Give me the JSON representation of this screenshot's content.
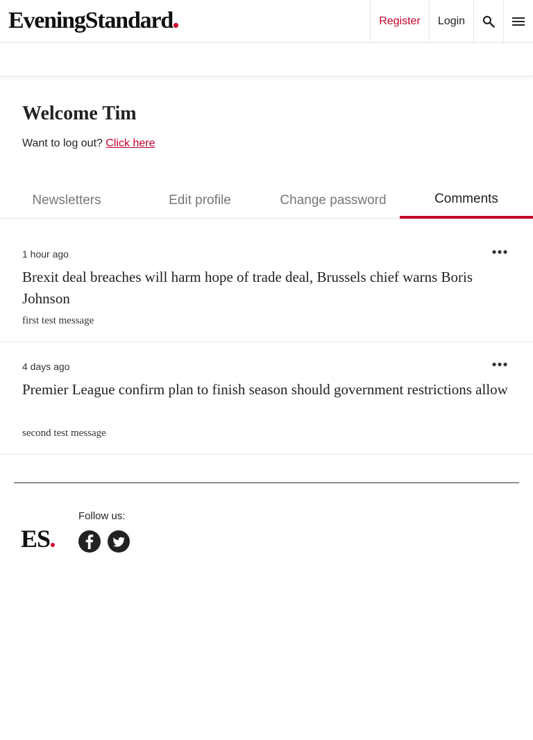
{
  "header": {
    "logo_text": "EveningStandard",
    "register_label": "Register",
    "login_label": "Login",
    "search_icon": "search-icon",
    "menu_icon": "hamburger-menu-icon",
    "accent_color": "#c4002a"
  },
  "welcome": {
    "title": "Welcome Tim",
    "logout_prompt": "Want to log out?",
    "logout_link": "Click here"
  },
  "tabs": [
    {
      "label": "Newsletters",
      "active": false
    },
    {
      "label": "Edit profile",
      "active": false
    },
    {
      "label": "Change password",
      "active": false
    },
    {
      "label": "Comments",
      "active": true
    }
  ],
  "comments": [
    {
      "time": "1 hour ago",
      "title": "Brexit deal breaches will harm hope of trade deal, Brussels chief warns Boris Johnson",
      "message": "first test message"
    },
    {
      "time": "4 days ago",
      "title": "Premier League confirm plan to finish season should government restrictions allow",
      "message": "second test message"
    }
  ],
  "footer": {
    "logo_text": "ES",
    "follow_label": "Follow us:",
    "social": [
      "facebook-icon",
      "twitter-icon"
    ]
  }
}
